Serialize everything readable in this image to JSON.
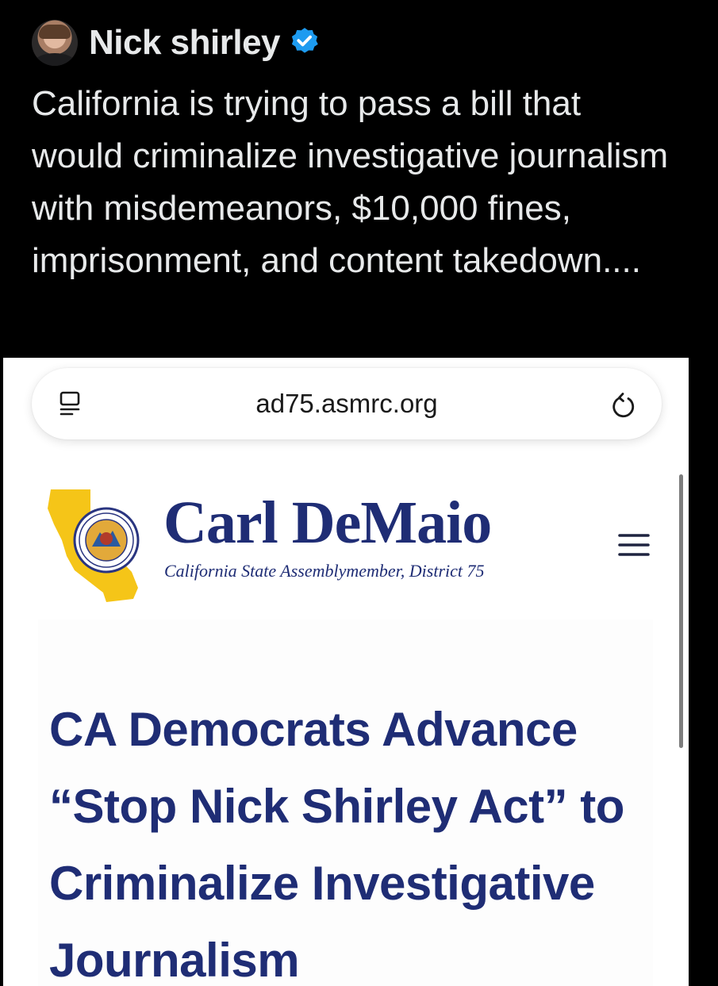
{
  "tweet": {
    "author_name": "Nick shirley",
    "verified": true,
    "text": "California is trying to pass a bill that would criminalize investigative journalism with misdemeanors, $10,000 fines, imprisonment, and content takedown...."
  },
  "embed": {
    "url": "ad75.asmrc.org",
    "site": {
      "brand_name": "Carl DeMaio",
      "brand_subtitle": "California State Assemblymember, District 75",
      "seal_text": "GREAT SEAL OF THE STATE OF CALIFORNIA"
    },
    "headline": "CA Democrats Advance “Stop Nick Shirley Act” to Criminalize Investigative Journalism"
  },
  "icons": {
    "verified": "verified-badge-icon",
    "reader": "reader-mode-icon",
    "reload": "reload-icon",
    "menu": "hamburger-menu-icon"
  },
  "colors": {
    "background": "#000000",
    "text": "#e7e9ea",
    "verified": "#1d9bf0",
    "brand_navy": "#1f2d75",
    "state_gold": "#f5c518"
  }
}
